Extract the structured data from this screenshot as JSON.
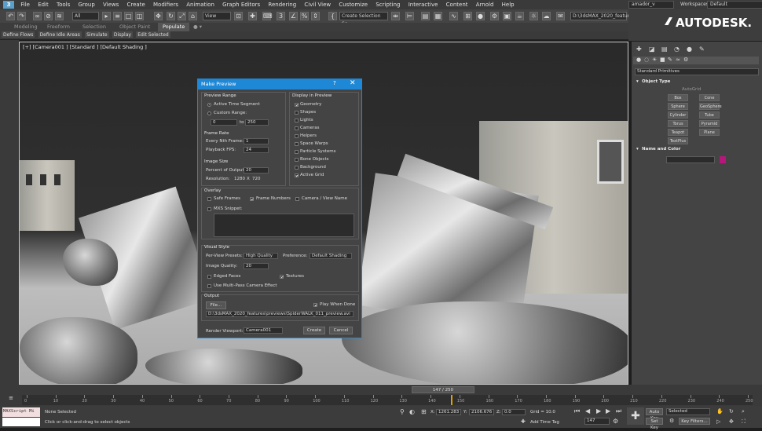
{
  "menu": {
    "items": [
      "File",
      "Edit",
      "Tools",
      "Group",
      "Views",
      "Create",
      "Modifiers",
      "Animation",
      "Graph Editors",
      "Rendering",
      "Civil View",
      "Customize",
      "Scripting",
      "Interactive",
      "Content",
      "Arnold",
      "Help"
    ],
    "user": "amador_v",
    "workspaces_label": "Workspaces:",
    "workspace": "Default"
  },
  "toolbar": {
    "filter": "All",
    "coord": "View",
    "selection_set": "Create Selection Se",
    "path": "D:\\3dsMAX_2020_features"
  },
  "brand": "AUTODESK.",
  "ribbon": {
    "tabs": [
      "Modeling",
      "Freeform",
      "Selection",
      "Object Paint",
      "Populate"
    ],
    "active": "Populate",
    "commands": [
      "Define Flows",
      "Define Idle Areas",
      "Simulate",
      "Display",
      "Edit Selected"
    ]
  },
  "viewport": {
    "label": "[+] [Camera001 ] [Standard ] [Default Shading ]"
  },
  "dialog": {
    "title": "Make Preview",
    "help": "?",
    "close": "✕",
    "preview_range": {
      "header": "Preview Range",
      "active_time": "Active Time Segment",
      "custom_range": "Custom Range:",
      "from": "0",
      "to_label": "to",
      "to": "250"
    },
    "frame_rate": {
      "header": "Frame Rate",
      "every_nth_label": "Every Nth Frame:",
      "every_nth": "1",
      "fps_label": "Playback FPS:",
      "fps": "24"
    },
    "image_size": {
      "header": "Image Size",
      "percent_label": "Percent of Output:",
      "percent": "20",
      "resolution_label": "Resolution:",
      "width": "1280",
      "x": "X",
      "height": "720"
    },
    "display": {
      "header": "Display in Preview",
      "items": [
        {
          "label": "Geometry",
          "checked": true
        },
        {
          "label": "Shapes",
          "checked": false
        },
        {
          "label": "Lights",
          "checked": false
        },
        {
          "label": "Cameras",
          "checked": false
        },
        {
          "label": "Helpers",
          "checked": false
        },
        {
          "label": "Space Warps",
          "checked": false
        },
        {
          "label": "Particle Systems",
          "checked": false
        },
        {
          "label": "Bone Objects",
          "checked": false
        },
        {
          "label": "Background",
          "checked": false
        },
        {
          "label": "Active Grid",
          "checked": true
        }
      ]
    },
    "overlay": {
      "header": "Overlay",
      "safe_frames": "Safe Frames",
      "frame_numbers": "Frame Numbers",
      "camera_view_name": "Camera / View Name",
      "mxs_snippet": "MXS Snippet:"
    },
    "visual_style": {
      "header": "Visual Style",
      "presets_label": "Per-View Presets:",
      "preset": "High Quality",
      "preference_label": "Preference:",
      "preference": "Default Shading",
      "quality_label": "Image Quality:",
      "quality": "20",
      "edged_faces": "Edged Faces",
      "textures": "Textures",
      "multipass": "Use Multi-Pass Camera Effect"
    },
    "output": {
      "header": "Output",
      "file_button": "File...",
      "play_when_done": "Play When Done",
      "path": "D:\\3dsMAX_2020_features\\previews\\SpiderWALK_011_preview.avi"
    },
    "render_viewport_label": "Render Viewport:",
    "render_viewport": "Camera001",
    "create": "Create",
    "cancel": "Cancel"
  },
  "command_panel": {
    "dropdown": "Standard Primitives",
    "object_type": "Object Type",
    "autogrid": "AutoGrid",
    "buttons": [
      "Box",
      "Cone",
      "Sphere",
      "GeoSphere",
      "Cylinder",
      "Tube",
      "Torus",
      "Pyramid",
      "Teapot",
      "Plane",
      "TextPlus"
    ],
    "name_and_color": "Name and Color",
    "color": "#b5177a"
  },
  "timeline": {
    "slider": "147 / 250",
    "ticks": [
      "0",
      "10",
      "20",
      "30",
      "40",
      "50",
      "60",
      "70",
      "80",
      "90",
      "100",
      "110",
      "120",
      "130",
      "140",
      "150",
      "160",
      "170",
      "180",
      "190",
      "200",
      "210",
      "220",
      "230",
      "240",
      "250"
    ]
  },
  "status": {
    "maxscript": "MAXScript Mi",
    "selection": "None Selected",
    "prompt": "Click or click-and-drag to select objects",
    "x_label": "X:",
    "x": "1261.283",
    "y_label": "Y:",
    "y": "2106.676",
    "z_label": "Z:",
    "z": "0.0",
    "grid": "Grid = 10.0",
    "add_time_tag": "Add Time Tag",
    "auto_key": "Auto Key",
    "selected": "Selected",
    "set_key": "Set Key",
    "key_filters": "Key Filters...",
    "frame": "147"
  }
}
